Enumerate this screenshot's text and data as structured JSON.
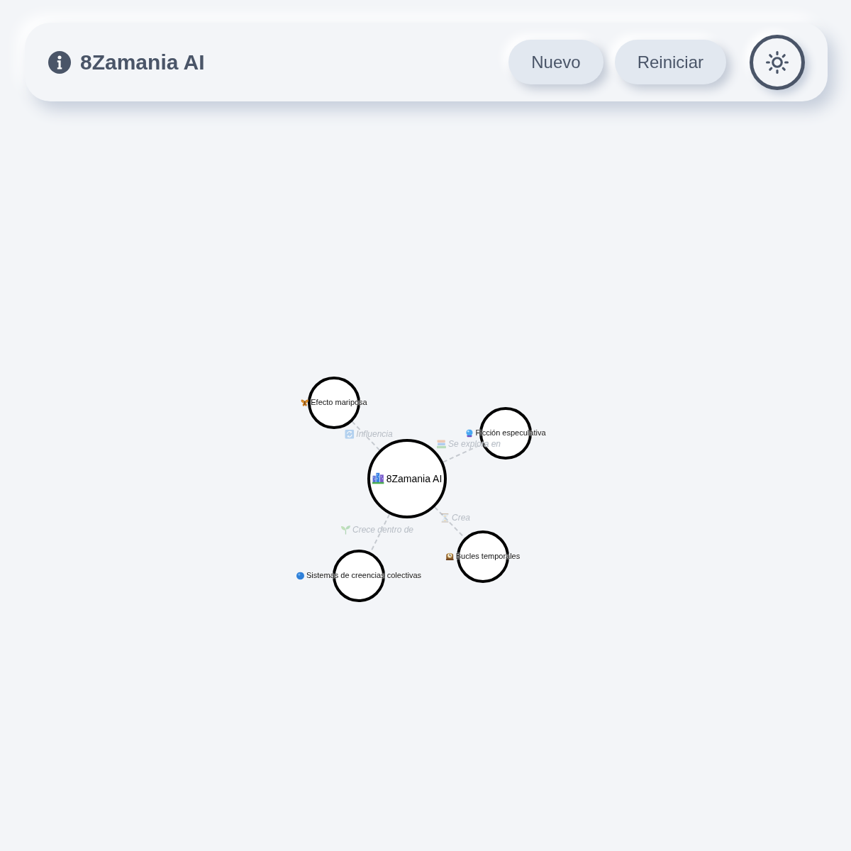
{
  "header": {
    "title": "8Zamania AI",
    "buttons": [
      {
        "label": "Nuevo"
      },
      {
        "label": "Reiniciar"
      }
    ]
  },
  "graph": {
    "center_node": {
      "label": "8Zamania AI"
    },
    "linked_nodes": [
      {
        "label": "Efecto mariposa",
        "edge_label": "Influencia"
      },
      {
        "label": "Ficción especulativa",
        "edge_label": "Se explora en"
      },
      {
        "label": "Bucles temporales",
        "edge_label": "Crea"
      },
      {
        "label": "Sistemas de creencias colectivas",
        "edge_label": "Crece dentro de"
      }
    ]
  }
}
